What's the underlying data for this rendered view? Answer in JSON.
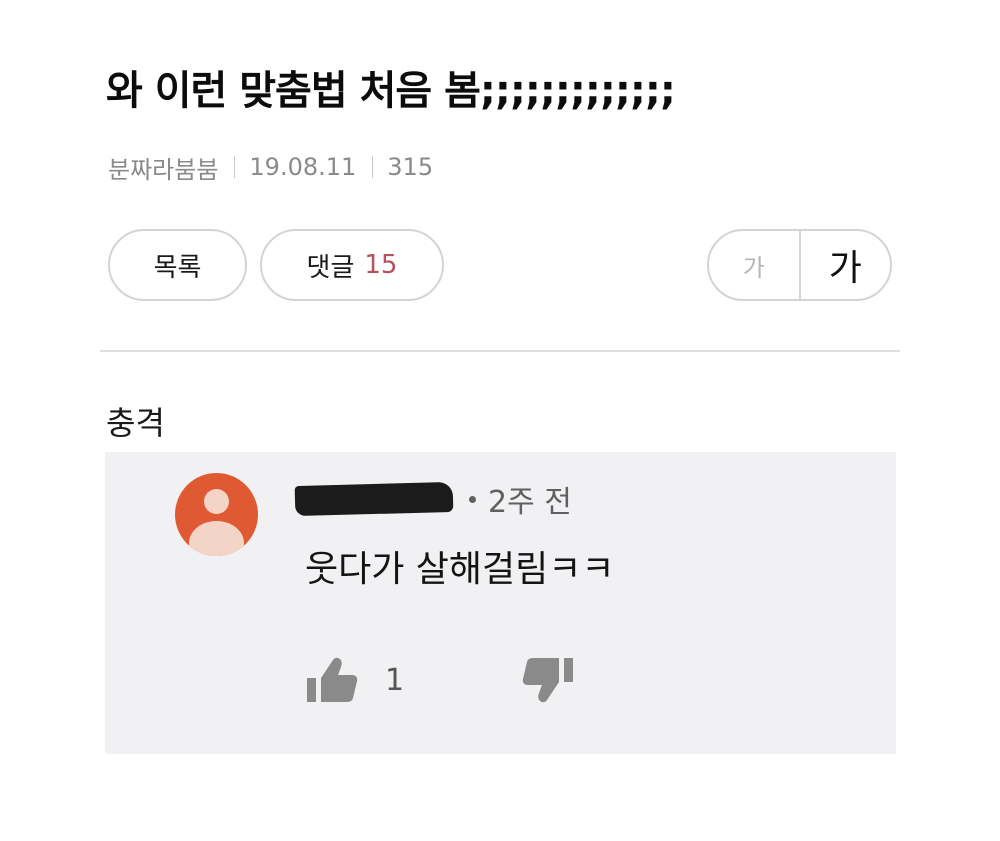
{
  "post": {
    "title": "와 이런 맞춤법 처음 봄;;;;;;;;;;;;;",
    "author": "분짜라붐붐",
    "date": "19.08.11",
    "views": "315"
  },
  "buttons": {
    "list_label": "목록",
    "comments_label": "댓글",
    "comments_count": "15",
    "font_small_label": "가",
    "font_large_label": "가"
  },
  "content": {
    "caption": "충격"
  },
  "comment": {
    "time": "2주 전",
    "text": "웃다가 살해걸림ㅋㅋ",
    "likes": "1"
  },
  "colors": {
    "avatar_bg": "#df5a33",
    "comment_count_accent": "#b8505d",
    "comment_card_bg": "#f1f1f3"
  },
  "icons": [
    "person-avatar-icon",
    "thumbs-up-icon",
    "thumbs-down-icon"
  ]
}
